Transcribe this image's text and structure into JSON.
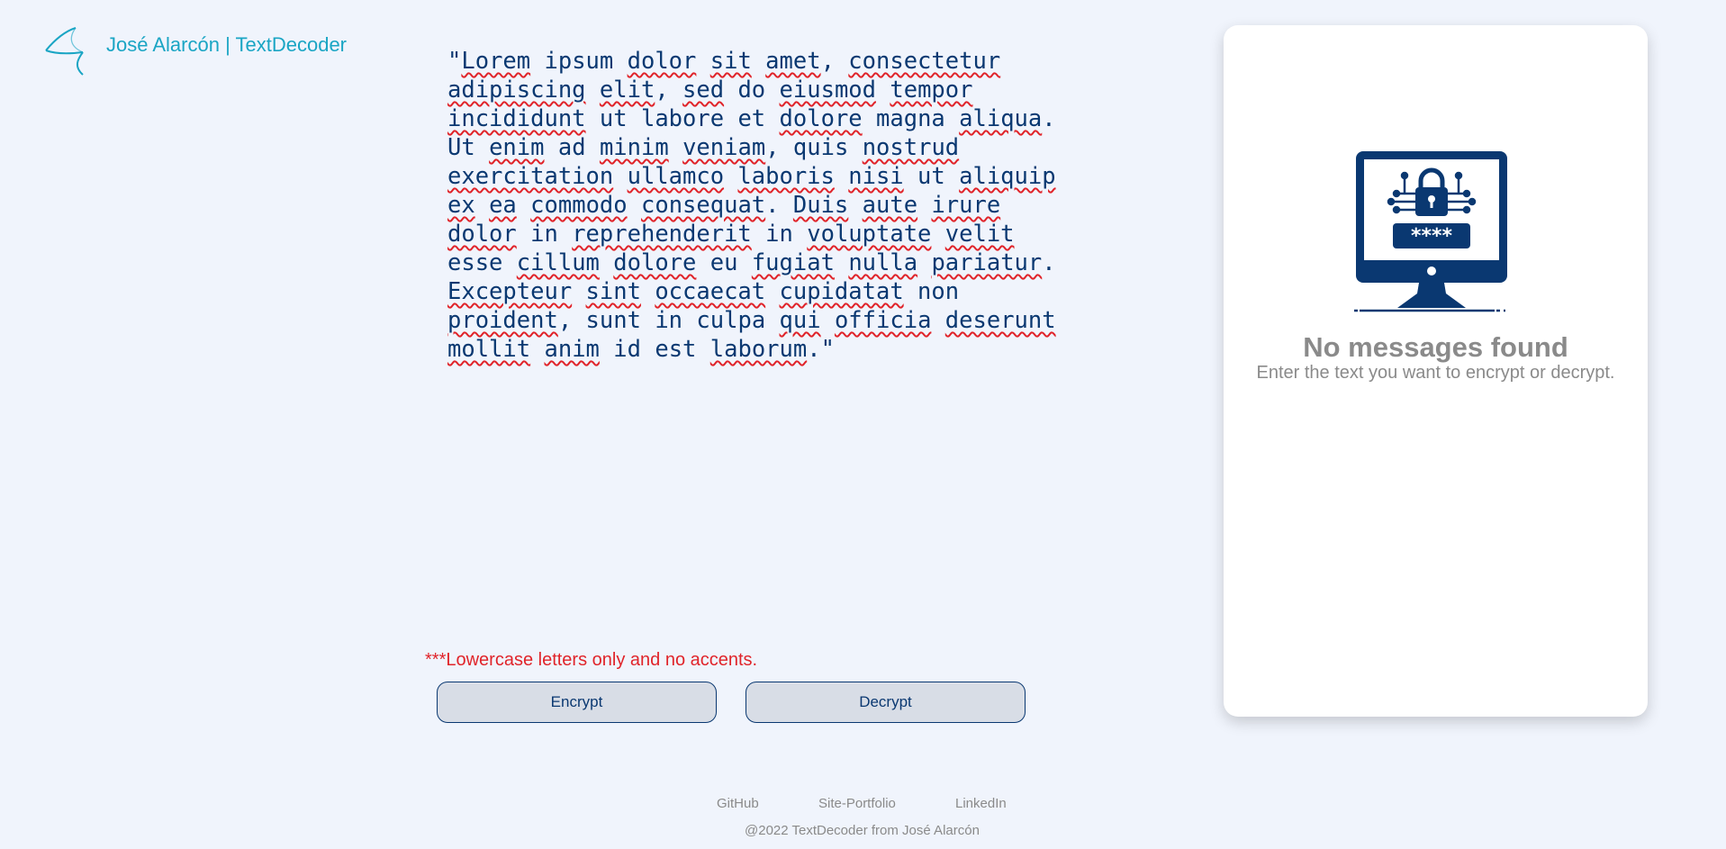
{
  "header": {
    "brand": "José Alarcón | TextDecoder",
    "logo_icon": "triangle-swirl-logo-icon"
  },
  "editor": {
    "text": "\"Lorem ipsum dolor sit amet, consectetur adipiscing elit, sed do eiusmod tempor incididunt ut labore et dolore magna aliqua. Ut enim ad minim veniam, quis nostrud exercitation ullamco laboris nisi ut aliquip ex ea commodo consequat. Duis aute irure dolor in reprehenderit in voluptate velit esse cillum dolore eu fugiat nulla pariatur. Excepteur sint occaecat cupidatat non proident, sunt in culpa qui officia deserunt mollit anim id est laborum.\""
  },
  "warning": "***Lowercase letters only and no accents.",
  "buttons": {
    "encrypt": "Encrypt",
    "decrypt": "Decrypt"
  },
  "output": {
    "illustration_icon": "monitor-lock-password-icon",
    "empty_title": "No messages found",
    "empty_subtitle": "Enter the text you want to encrypt or decrypt."
  },
  "footer": {
    "links": [
      "GitHub",
      "Site-Portfolio",
      "LinkedIn"
    ],
    "copyright": "@2022 TextDecoder from José Alarcón"
  },
  "colors": {
    "background": "#f0f4fc",
    "primary": "#0a3871",
    "brand": "#1aa5c4",
    "warning": "#e0242a",
    "muted": "#8a8a8a"
  }
}
